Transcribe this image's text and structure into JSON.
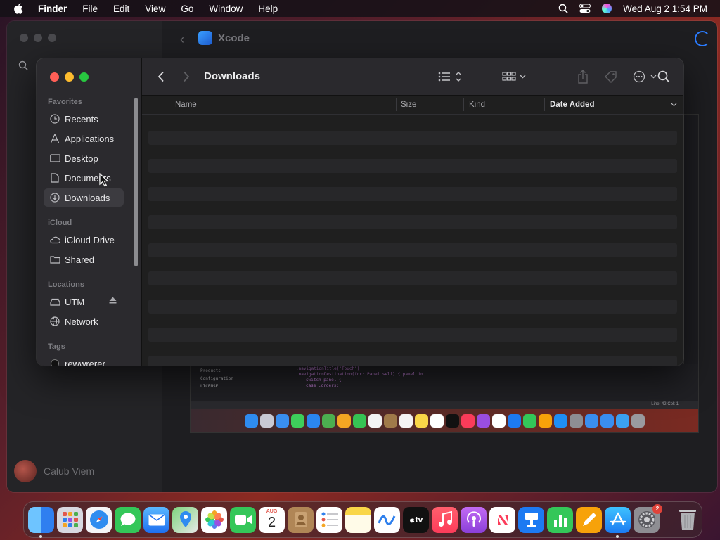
{
  "menubar": {
    "app_name": "Finder",
    "menus": [
      "File",
      "Edit",
      "View",
      "Go",
      "Window",
      "Help"
    ],
    "clock": "Wed Aug 2  1:54 PM"
  },
  "background_app": {
    "title": "Xcode",
    "user_name": "Calub Viem",
    "code_files": [
      "Products",
      "Configuration",
      "LICENSE"
    ],
    "code_lines": [
      ".navigationTitle(\"Touch\")",
      ".navigationDestination(for: Panel.self) { panel in",
      "switch panel {",
      "case .orders:"
    ],
    "status_text": "Line: 42  Col: 1"
  },
  "finder": {
    "title": "Downloads",
    "sidebar": {
      "favorites_label": "Favorites",
      "favorites": [
        {
          "label": "Recents",
          "icon": "clock-icon"
        },
        {
          "label": "Applications",
          "icon": "applications-icon"
        },
        {
          "label": "Desktop",
          "icon": "desktop-icon"
        },
        {
          "label": "Documents",
          "icon": "document-icon"
        },
        {
          "label": "Downloads",
          "icon": "download-icon",
          "selected": true
        }
      ],
      "icloud_label": "iCloud",
      "icloud": [
        {
          "label": "iCloud Drive",
          "icon": "cloud-icon"
        },
        {
          "label": "Shared",
          "icon": "shared-folder-icon"
        }
      ],
      "locations_label": "Locations",
      "locations": [
        {
          "label": "UTM",
          "icon": "drive-icon"
        },
        {
          "label": "Network",
          "icon": "globe-icon"
        }
      ],
      "tags_label": "Tags",
      "tags": [
        {
          "label": "rewwrerer",
          "icon": "tag-dot-icon"
        }
      ]
    },
    "columns": {
      "name": "Name",
      "size": "Size",
      "kind": "Kind",
      "date_added": "Date Added"
    }
  },
  "dock": {
    "calendar_month": "AUG",
    "calendar_day": "2",
    "tv_label": "tv",
    "settings_badge": "2"
  },
  "colors": {
    "close": "#ff5f57",
    "minimize": "#febc2e",
    "zoom": "#28c840",
    "accent": "#2b7cff"
  }
}
